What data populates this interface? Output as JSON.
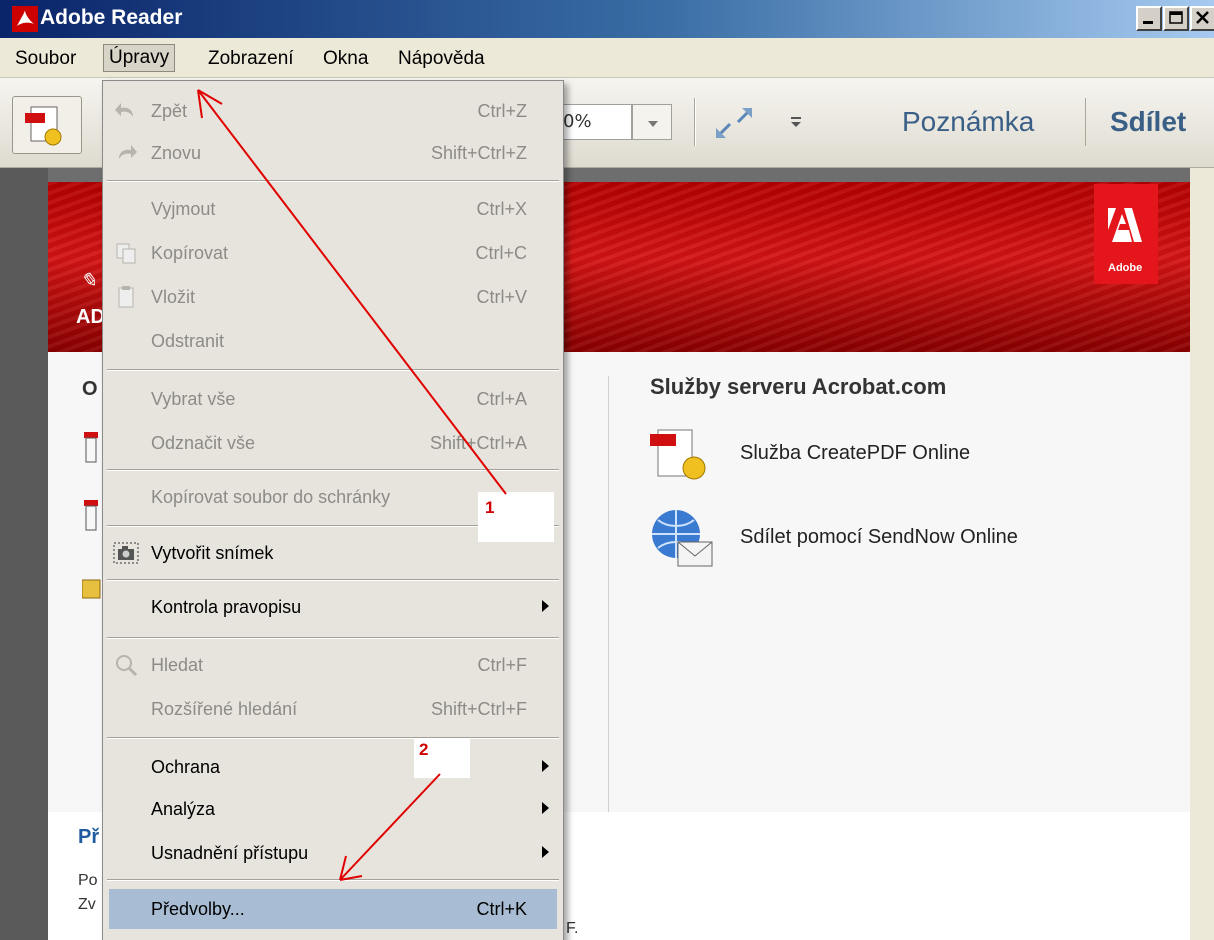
{
  "window": {
    "title": "Adobe Reader"
  },
  "menubar": {
    "items": [
      {
        "label": "Soubor"
      },
      {
        "label": "Úpravy"
      },
      {
        "label": "Zobrazení"
      },
      {
        "label": "Okna"
      },
      {
        "label": "Nápověda"
      }
    ]
  },
  "toolbar": {
    "zoom_value": "0%",
    "links": [
      "Poznámka",
      "Sdílet"
    ]
  },
  "edit_menu": {
    "items": [
      {
        "label": "Zpět",
        "shortcut": "Ctrl+Z",
        "disabled": true,
        "icon": "undo-icon"
      },
      {
        "label": "Znovu",
        "shortcut": "Shift+Ctrl+Z",
        "disabled": true,
        "icon": "redo-icon"
      },
      {
        "label": "Vyjmout",
        "shortcut": "Ctrl+X",
        "disabled": true
      },
      {
        "label": "Kopírovat",
        "shortcut": "Ctrl+C",
        "disabled": true,
        "icon": "copy-icon"
      },
      {
        "label": "Vložit",
        "shortcut": "Ctrl+V",
        "disabled": true,
        "icon": "paste-icon"
      },
      {
        "label": "Odstranit",
        "shortcut": "",
        "disabled": true
      },
      {
        "label": "Vybrat vše",
        "shortcut": "Ctrl+A",
        "disabled": true
      },
      {
        "label": "Odznačit vše",
        "shortcut": "Shift+Ctrl+A",
        "disabled": true
      },
      {
        "label": "Kopírovat soubor do schránky",
        "shortcut": "",
        "disabled": true
      },
      {
        "label": "Vytvořit snímek",
        "shortcut": "",
        "disabled": false,
        "icon": "camera-icon"
      },
      {
        "label": "Kontrola pravopisu",
        "shortcut": "",
        "disabled": false,
        "submenu": true
      },
      {
        "label": "Hledat",
        "shortcut": "Ctrl+F",
        "disabled": true,
        "icon": "search-icon"
      },
      {
        "label": "Rozšířené hledání",
        "shortcut": "Shift+Ctrl+F",
        "disabled": true
      },
      {
        "label": "Ochrana",
        "shortcut": "",
        "disabled": false,
        "submenu": true
      },
      {
        "label": "Analýza",
        "shortcut": "",
        "disabled": false,
        "submenu": true
      },
      {
        "label": "Usnadnění přístupu",
        "shortcut": "",
        "disabled": false,
        "submenu": true
      },
      {
        "label": "Předvolby...",
        "shortcut": "Ctrl+K",
        "disabled": false,
        "highlighted": true
      }
    ]
  },
  "welcome": {
    "services_title": "Služby serveru Acrobat.com",
    "services": [
      {
        "label": "Služba CreatePDF Online",
        "icon": "createpdf-icon"
      },
      {
        "label": "Sdílet pomocí SendNow Online",
        "icon": "sendnow-icon"
      }
    ],
    "adobe_logo_text": "Adobe",
    "banner_fragment": "AD",
    "left_fragments": [
      "O",
      "Př",
      "Po",
      "Zv",
      "F."
    ]
  },
  "annotations": {
    "step1": "1",
    "step2": "2"
  },
  "colors": {
    "titlebar_start": "#0a246a",
    "banner_red": "#d41414",
    "highlight": "#a8bdd3",
    "annotation_red": "#d00000",
    "link_blue": "#3a5f86"
  }
}
